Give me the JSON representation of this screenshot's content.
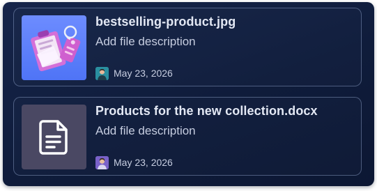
{
  "files": [
    {
      "name": "bestselling-product.jpg",
      "description": "Add file description",
      "date": "May 23, 2026",
      "thumbnail_icon": "clipboard-tag-illustration",
      "avatar_color": "#2a8fa0"
    },
    {
      "name": "Products for the new collection.docx",
      "description": "Add file description",
      "date": "May 23, 2026",
      "thumbnail_icon": "document-icon",
      "avatar_color": "#7a62c9"
    }
  ]
}
